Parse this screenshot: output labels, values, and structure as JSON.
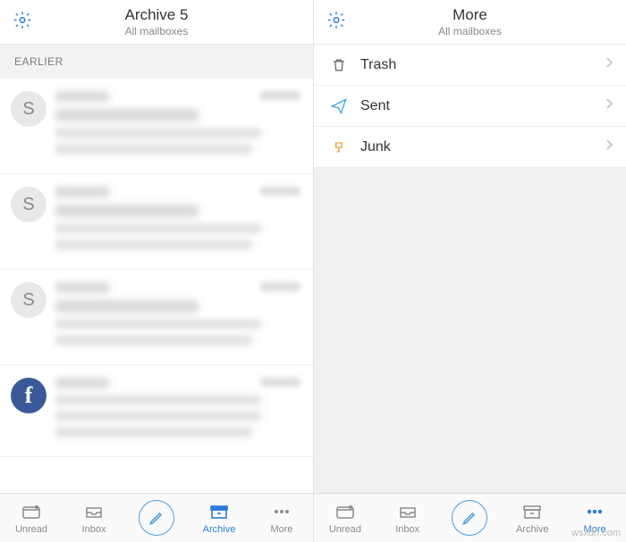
{
  "left": {
    "header": {
      "title": "Archive 5",
      "subtitle": "All mailboxes"
    },
    "section": "EARLIER",
    "emails": [
      {
        "avatar": "S",
        "avatar_kind": "letter"
      },
      {
        "avatar": "S",
        "avatar_kind": "letter"
      },
      {
        "avatar": "S",
        "avatar_kind": "letter"
      },
      {
        "avatar": "f",
        "avatar_kind": "fb"
      }
    ],
    "tabs": {
      "unread": "Unread",
      "inbox": "Inbox",
      "archive": "Archive",
      "more": "More"
    }
  },
  "right": {
    "header": {
      "title": "More",
      "subtitle": "All mailboxes"
    },
    "menu": [
      {
        "key": "trash",
        "label": "Trash"
      },
      {
        "key": "sent",
        "label": "Sent"
      },
      {
        "key": "junk",
        "label": "Junk"
      }
    ],
    "tabs": {
      "unread": "Unread",
      "inbox": "Inbox",
      "archive": "Archive",
      "more": "More"
    }
  },
  "colors": {
    "accent": "#2b7dd6",
    "trash": "#6f6f6f",
    "sent": "#3ea5df",
    "junk": "#e8a33d"
  },
  "watermark": "wsxdn.com"
}
